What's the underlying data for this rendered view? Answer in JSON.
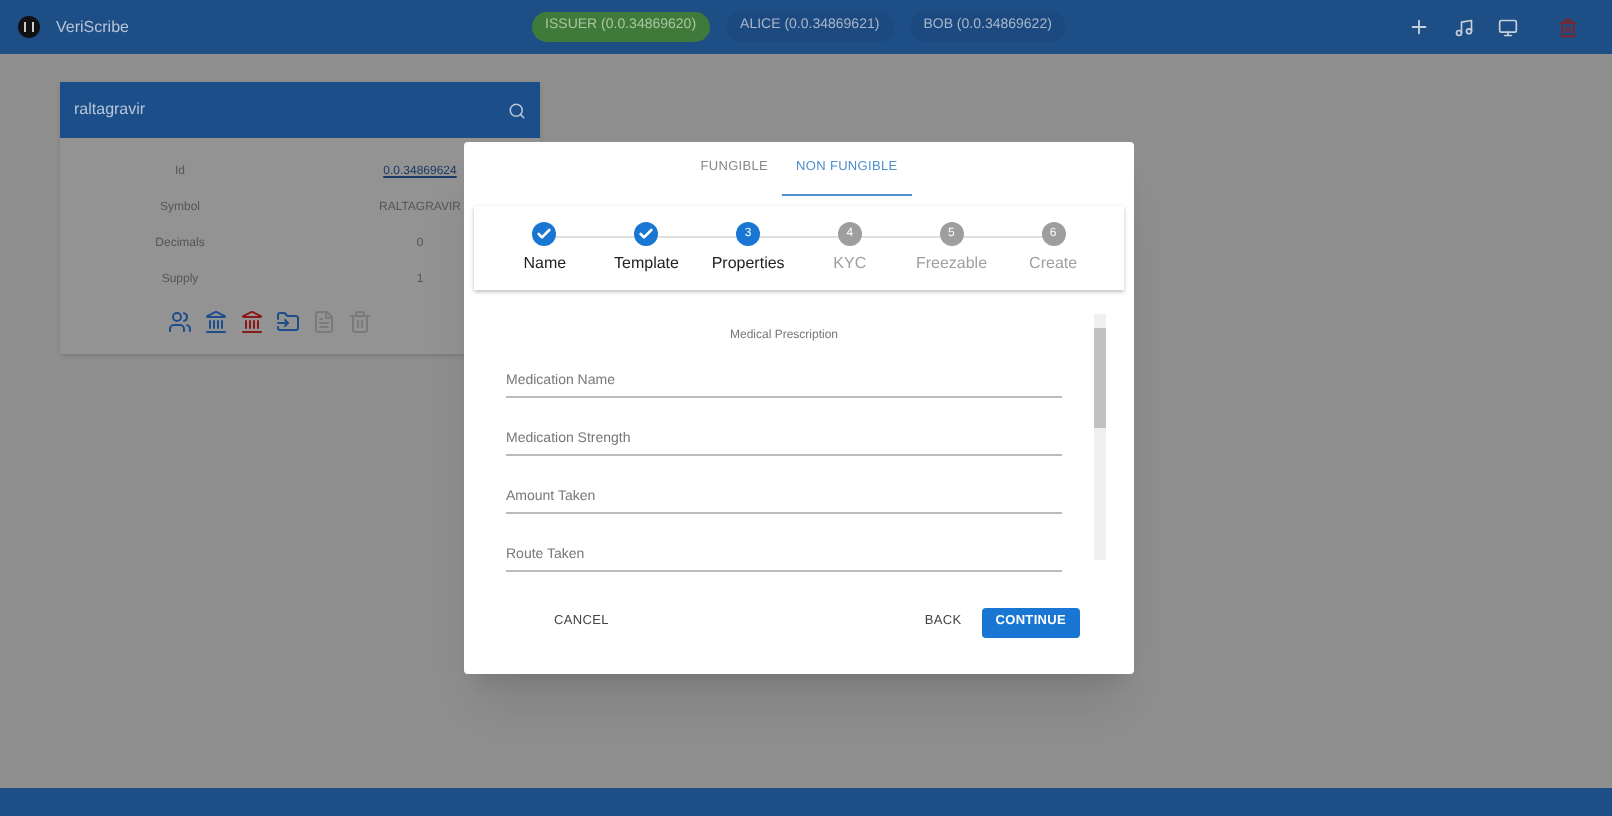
{
  "app": {
    "title": "VeriScribe"
  },
  "accounts": [
    {
      "label": "ISSUER (0.0.34869620)",
      "selected": true
    },
    {
      "label": "ALICE (0.0.34869621)",
      "selected": false
    },
    {
      "label": "BOB (0.0.34869622)",
      "selected": false
    }
  ],
  "search": {
    "value": "raltagravir"
  },
  "token": {
    "rows": [
      {
        "label": "Id",
        "value": "0.0.34869624",
        "kind": "link"
      },
      {
        "label": "Symbol",
        "value": "RALTAGRAVIR",
        "kind": "text"
      },
      {
        "label": "Decimals",
        "value": "0",
        "kind": "text"
      },
      {
        "label": "Supply",
        "value": "1",
        "kind": "text"
      }
    ],
    "actions": [
      {
        "kind": "people",
        "disabled": false
      },
      {
        "kind": "bank-plus",
        "disabled": false
      },
      {
        "kind": "bank-minus",
        "disabled": false
      },
      {
        "kind": "transfer",
        "disabled": false
      },
      {
        "kind": "document",
        "disabled": true
      },
      {
        "kind": "trash",
        "disabled": true
      }
    ]
  },
  "dialog": {
    "tabs": [
      {
        "label": "FUNGIBLE",
        "selected": false
      },
      {
        "label": "NON FUNGIBLE",
        "selected": true
      }
    ],
    "steps": [
      {
        "label": "Name",
        "kind": "done"
      },
      {
        "label": "Template",
        "kind": "done"
      },
      {
        "number": "3",
        "label": "Properties",
        "kind": "active"
      },
      {
        "number": "4",
        "label": "KYC",
        "kind": "pending"
      },
      {
        "number": "5",
        "label": "Freezable",
        "kind": "pending"
      },
      {
        "number": "6",
        "label": "Create",
        "kind": "pending"
      }
    ],
    "form_title": "Medical Prescription",
    "fields": [
      {
        "placeholder": "Medication Name"
      },
      {
        "placeholder": "Medication Strength"
      },
      {
        "placeholder": "Amount Taken"
      },
      {
        "placeholder": "Route Taken"
      }
    ],
    "buttons": {
      "cancel": "CANCEL",
      "back": "BACK",
      "continue": "CONTINUE"
    }
  }
}
